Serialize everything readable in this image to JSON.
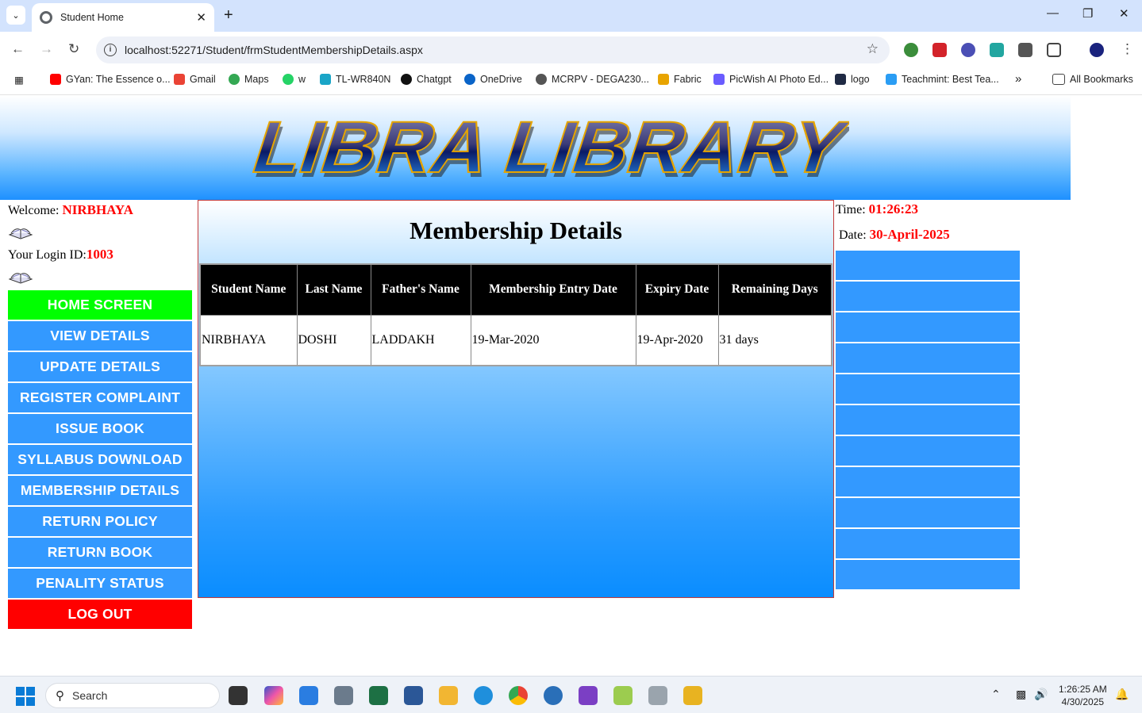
{
  "browser": {
    "tab_title": "Student Home",
    "url": "localhost:52271/Student/frmStudentMembershipDetails.aspx",
    "bookmarks": [
      {
        "label": "GYan: The Essence o...",
        "color": "#ff0000"
      },
      {
        "label": "Gmail",
        "color": "#ea4335"
      },
      {
        "label": "Maps",
        "color": "#34a853"
      },
      {
        "label": "w",
        "color": "#25d366"
      },
      {
        "label": "TL-WR840N",
        "color": "#1aa5c7"
      },
      {
        "label": "Chatgpt",
        "color": "#111111"
      },
      {
        "label": "OneDrive",
        "color": "#0a64c8"
      },
      {
        "label": "MCRPV - DEGA230...",
        "color": "#555555"
      },
      {
        "label": "Fabric",
        "color": "#e8a400"
      },
      {
        "label": "PicWish AI Photo Ed...",
        "color": "#6a5cff"
      },
      {
        "label": "logo",
        "color": "#1f2a44"
      },
      {
        "label": "Teachmint: Best Tea...",
        "color": "#2a9df4"
      }
    ],
    "all_bookmarks_label": "All Bookmarks"
  },
  "banner": {
    "logo_text": "LIBRA LIBRARY"
  },
  "sidebar": {
    "welcome_label": "Welcome: ",
    "user_name": "NIRBHAYA",
    "login_id_label": "Your Login ID:",
    "login_id": "1003",
    "menu": [
      {
        "label": "HOME SCREEN",
        "variant": "home"
      },
      {
        "label": "VIEW DETAILS",
        "variant": "normal"
      },
      {
        "label": "UPDATE DETAILS",
        "variant": "normal"
      },
      {
        "label": "REGISTER COMPLAINT",
        "variant": "normal"
      },
      {
        "label": "ISSUE BOOK",
        "variant": "normal"
      },
      {
        "label": "SYLLABUS DOWNLOAD",
        "variant": "normal"
      },
      {
        "label": "MEMBERSHIP DETAILS",
        "variant": "normal"
      },
      {
        "label": "RETURN POLICY",
        "variant": "normal"
      },
      {
        "label": "RETURN BOOK",
        "variant": "normal"
      },
      {
        "label": "PENALITY STATUS",
        "variant": "normal"
      },
      {
        "label": "LOG OUT",
        "variant": "logout"
      }
    ]
  },
  "main": {
    "title": "Membership Details",
    "table": {
      "headers": [
        "Student Name",
        "Last Name",
        "Father's Name",
        "Membership Entry Date",
        "Expiry Date",
        "Remaining Days"
      ],
      "rows": [
        [
          "NIRBHAYA",
          "DOSHI",
          "LADDAKH",
          "19-Mar-2020",
          "19-Apr-2020",
          "31 days"
        ]
      ]
    }
  },
  "right_panel": {
    "time_label": "Time: ",
    "time_value": "01:26:23",
    "date_label": "Date: ",
    "date_value": "30-April-2025",
    "slot_count": 11
  },
  "taskbar": {
    "search_placeholder": "Search",
    "time": "1:26:25 AM",
    "date": "4/30/2025"
  },
  "colors": {
    "menu_blue": "#3399ff",
    "home_green": "#00ff00",
    "logout_red": "#ff0000",
    "value_red": "#ff0000"
  }
}
